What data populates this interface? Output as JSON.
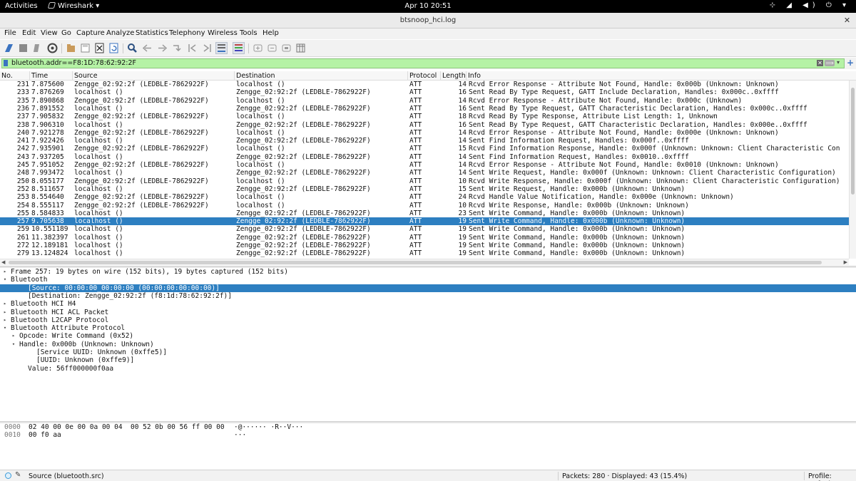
{
  "topbar": {
    "activities": "Activities",
    "app_name": "Wireshark",
    "clock": "Apr 10  20:51",
    "system_icons": "⊹ ◢ ◀) ⏻ ▾"
  },
  "window": {
    "title": "btsnoop_hci.log",
    "close": "✕"
  },
  "menu": {
    "file": "File",
    "edit": "Edit",
    "view": "View",
    "go": "Go",
    "capture": "Capture",
    "analyze": "Analyze",
    "statistics": "Statistics",
    "telephony": "Telephony",
    "wireless": "Wireless",
    "tools": "Tools",
    "help": "Help"
  },
  "filter": {
    "value": "bluetooth.addr==F8:1D:78:62:92:2F",
    "apply": "⟹",
    "clear": "✕",
    "dropdown": "▾",
    "add": "+"
  },
  "packet_list": {
    "headers": {
      "no": "No.",
      "time": "Time",
      "source": "Source",
      "destination": "Destination",
      "protocol": "Protocol",
      "length": "Length",
      "info": "Info"
    },
    "rows": [
      {
        "no": "231",
        "time": "7.875600",
        "src": "Zengge_02:92:2f (LEDBLE-7862922F)",
        "dst": "localhost ()",
        "proto": "ATT",
        "len": "14",
        "info": "Rcvd Error Response - Attribute Not Found, Handle: 0x000b (Unknown: Unknown)"
      },
      {
        "no": "233",
        "time": "7.876269",
        "src": "localhost ()",
        "dst": "Zengge_02:92:2f (LEDBLE-7862922F)",
        "proto": "ATT",
        "len": "16",
        "info": "Sent Read By Type Request, GATT Include Declaration, Handles: 0x000c..0xffff"
      },
      {
        "no": "235",
        "time": "7.890868",
        "src": "Zengge_02:92:2f (LEDBLE-7862922F)",
        "dst": "localhost ()",
        "proto": "ATT",
        "len": "14",
        "info": "Rcvd Error Response - Attribute Not Found, Handle: 0x000c (Unknown)"
      },
      {
        "no": "236",
        "time": "7.891552",
        "src": "localhost ()",
        "dst": "Zengge_02:92:2f (LEDBLE-7862922F)",
        "proto": "ATT",
        "len": "16",
        "info": "Sent Read By Type Request, GATT Characteristic Declaration, Handles: 0x000c..0xffff"
      },
      {
        "no": "237",
        "time": "7.905832",
        "src": "Zengge_02:92:2f (LEDBLE-7862922F)",
        "dst": "localhost ()",
        "proto": "ATT",
        "len": "18",
        "info": "Rcvd Read By Type Response, Attribute List Length: 1, Unknown"
      },
      {
        "no": "238",
        "time": "7.906310",
        "src": "localhost ()",
        "dst": "Zengge_02:92:2f (LEDBLE-7862922F)",
        "proto": "ATT",
        "len": "16",
        "info": "Sent Read By Type Request, GATT Characteristic Declaration, Handles: 0x000e..0xffff"
      },
      {
        "no": "240",
        "time": "7.921278",
        "src": "Zengge_02:92:2f (LEDBLE-7862922F)",
        "dst": "localhost ()",
        "proto": "ATT",
        "len": "14",
        "info": "Rcvd Error Response - Attribute Not Found, Handle: 0x000e (Unknown: Unknown)"
      },
      {
        "no": "241",
        "time": "7.922426",
        "src": "localhost ()",
        "dst": "Zengge_02:92:2f (LEDBLE-7862922F)",
        "proto": "ATT",
        "len": "14",
        "info": "Sent Find Information Request, Handles: 0x000f..0xffff"
      },
      {
        "no": "242",
        "time": "7.935901",
        "src": "Zengge_02:92:2f (LEDBLE-7862922F)",
        "dst": "localhost ()",
        "proto": "ATT",
        "len": "15",
        "info": "Rcvd Find Information Response, Handle: 0x000f (Unknown: Unknown: Client Characteristic Con"
      },
      {
        "no": "243",
        "time": "7.937205",
        "src": "localhost ()",
        "dst": "Zengge_02:92:2f (LEDBLE-7862922F)",
        "proto": "ATT",
        "len": "14",
        "info": "Sent Find Information Request, Handles: 0x0010..0xffff"
      },
      {
        "no": "245",
        "time": "7.951052",
        "src": "Zengge_02:92:2f (LEDBLE-7862922F)",
        "dst": "localhost ()",
        "proto": "ATT",
        "len": "14",
        "info": "Rcvd Error Response - Attribute Not Found, Handle: 0x0010 (Unknown: Unknown)"
      },
      {
        "no": "248",
        "time": "7.993472",
        "src": "localhost ()",
        "dst": "Zengge_02:92:2f (LEDBLE-7862922F)",
        "proto": "ATT",
        "len": "14",
        "info": "Sent Write Request, Handle: 0x000f (Unknown: Unknown: Client Characteristic Configuration)"
      },
      {
        "no": "250",
        "time": "8.055177",
        "src": "Zengge_02:92:2f (LEDBLE-7862922F)",
        "dst": "localhost ()",
        "proto": "ATT",
        "len": "10",
        "info": "Rcvd Write Response, Handle: 0x000f (Unknown: Unknown: Client Characteristic Configuration)"
      },
      {
        "no": "252",
        "time": "8.511657",
        "src": "localhost ()",
        "dst": "Zengge_02:92:2f (LEDBLE-7862922F)",
        "proto": "ATT",
        "len": "15",
        "info": "Sent Write Request, Handle: 0x000b (Unknown: Unknown)"
      },
      {
        "no": "253",
        "time": "8.554640",
        "src": "Zengge_02:92:2f (LEDBLE-7862922F)",
        "dst": "localhost ()",
        "proto": "ATT",
        "len": "24",
        "info": "Rcvd Handle Value Notification, Handle: 0x000e (Unknown: Unknown)"
      },
      {
        "no": "254",
        "time": "8.555117",
        "src": "Zengge_02:92:2f (LEDBLE-7862922F)",
        "dst": "localhost ()",
        "proto": "ATT",
        "len": "10",
        "info": "Rcvd Write Response, Handle: 0x000b (Unknown: Unknown)"
      },
      {
        "no": "255",
        "time": "8.584833",
        "src": "localhost ()",
        "dst": "Zengge_02:92:2f (LEDBLE-7862922F)",
        "proto": "ATT",
        "len": "23",
        "info": "Sent Write Command, Handle: 0x000b (Unknown: Unknown)"
      },
      {
        "no": "257",
        "time": "9.705638",
        "src": "localhost ()",
        "dst": "Zengge_02:92:2f (LEDBLE-7862922F)",
        "proto": "ATT",
        "len": "19",
        "info": "Sent Write Command, Handle: 0x000b (Unknown: Unknown)"
      },
      {
        "no": "259",
        "time": "10.551189",
        "src": "localhost ()",
        "dst": "Zengge_02:92:2f (LEDBLE-7862922F)",
        "proto": "ATT",
        "len": "19",
        "info": "Sent Write Command, Handle: 0x000b (Unknown: Unknown)"
      },
      {
        "no": "261",
        "time": "11.382397",
        "src": "localhost ()",
        "dst": "Zengge_02:92:2f (LEDBLE-7862922F)",
        "proto": "ATT",
        "len": "19",
        "info": "Sent Write Command, Handle: 0x000b (Unknown: Unknown)"
      },
      {
        "no": "272",
        "time": "12.189181",
        "src": "localhost ()",
        "dst": "Zengge_02:92:2f (LEDBLE-7862922F)",
        "proto": "ATT",
        "len": "19",
        "info": "Sent Write Command, Handle: 0x000b (Unknown: Unknown)"
      },
      {
        "no": "279",
        "time": "13.124824",
        "src": "localhost ()",
        "dst": "Zengge_02:92:2f (LEDBLE-7862922F)",
        "proto": "ATT",
        "len": "19",
        "info": "Sent Write Command, Handle: 0x000b (Unknown: Unknown)"
      }
    ],
    "selected_no": "257"
  },
  "details": [
    {
      "indent": 0,
      "twisty": "▸",
      "text": "Frame 257: 19 bytes on wire (152 bits), 19 bytes captured (152 bits)",
      "selected": false
    },
    {
      "indent": 0,
      "twisty": "▾",
      "text": "Bluetooth",
      "selected": false
    },
    {
      "indent": 2,
      "twisty": "",
      "text": "[Source: 00:00:00_00:00:00 (00:00:00:00:00:00)]",
      "selected": true
    },
    {
      "indent": 2,
      "twisty": "",
      "text": "[Destination: Zengge_02:92:2f (f8:1d:78:62:92:2f)]",
      "selected": false
    },
    {
      "indent": 0,
      "twisty": "▸",
      "text": "Bluetooth HCI H4",
      "selected": false
    },
    {
      "indent": 0,
      "twisty": "▸",
      "text": "Bluetooth HCI ACL Packet",
      "selected": false
    },
    {
      "indent": 0,
      "twisty": "▸",
      "text": "Bluetooth L2CAP Protocol",
      "selected": false
    },
    {
      "indent": 0,
      "twisty": "▾",
      "text": "Bluetooth Attribute Protocol",
      "selected": false
    },
    {
      "indent": 1,
      "twisty": "▸",
      "text": "Opcode: Write Command (0x52)",
      "selected": false
    },
    {
      "indent": 1,
      "twisty": "▾",
      "text": "Handle: 0x000b (Unknown: Unknown)",
      "selected": false
    },
    {
      "indent": 3,
      "twisty": "",
      "text": "[Service UUID: Unknown (0xffe5)]",
      "selected": false
    },
    {
      "indent": 3,
      "twisty": "",
      "text": "[UUID: Unknown (0xffe9)]",
      "selected": false
    },
    {
      "indent": 2,
      "twisty": "",
      "text": "Value: 56ff000000f0aa",
      "selected": false
    }
  ],
  "bytes": [
    {
      "offset": "0000",
      "hex": "02 40 00 0e 00 0a 00 04  00 52 0b 00 56 ff 00 00",
      "ascii": "·@······ ·R··V···"
    },
    {
      "offset": "0010",
      "hex": "00 f0 aa",
      "ascii": "···"
    }
  ],
  "status": {
    "field": "Source (bluetooth.src)",
    "packets": "Packets: 280 · Displayed: 43 (15.4%)",
    "profile": "Profile: Default"
  },
  "colors": {
    "selection": "#2d7fc1",
    "filter_valid": "#b5f2a5",
    "topbar": "#000000"
  }
}
